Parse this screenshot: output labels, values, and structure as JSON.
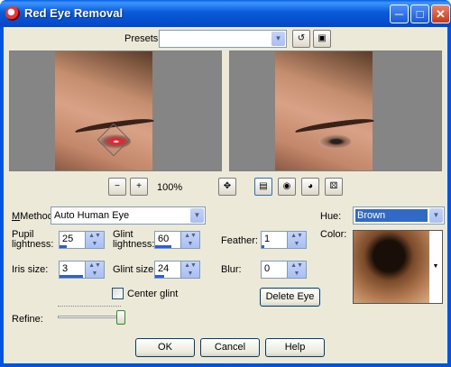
{
  "window": {
    "title": "Red Eye Removal"
  },
  "presets": {
    "label": "Presets:",
    "value": ""
  },
  "zoom": {
    "level": "100%"
  },
  "method": {
    "label": "Method:",
    "value": "Auto Human Eye"
  },
  "pupil_lightness": {
    "label_line1": "Pupil",
    "label_line2": "lightness:",
    "value": "25"
  },
  "glint_lightness": {
    "label_line1": "Glint",
    "label_line2": "lightness:",
    "value": "60"
  },
  "feather": {
    "label": "Feather:",
    "value": "1"
  },
  "iris_size": {
    "label": "Iris size:",
    "value": "3"
  },
  "glint_size": {
    "label": "Glint size:",
    "value": "24"
  },
  "blur": {
    "label": "Blur:",
    "value": "0"
  },
  "center_glint": {
    "label": "Center glint",
    "checked": false
  },
  "delete_eye": {
    "label": "Delete Eye"
  },
  "refine": {
    "label": "Refine:",
    "level": 1.0
  },
  "hue": {
    "label": "Hue:",
    "value": "Brown"
  },
  "color": {
    "label": "Color:"
  },
  "buttons": {
    "ok": "OK",
    "cancel": "Cancel",
    "help": "Help"
  }
}
